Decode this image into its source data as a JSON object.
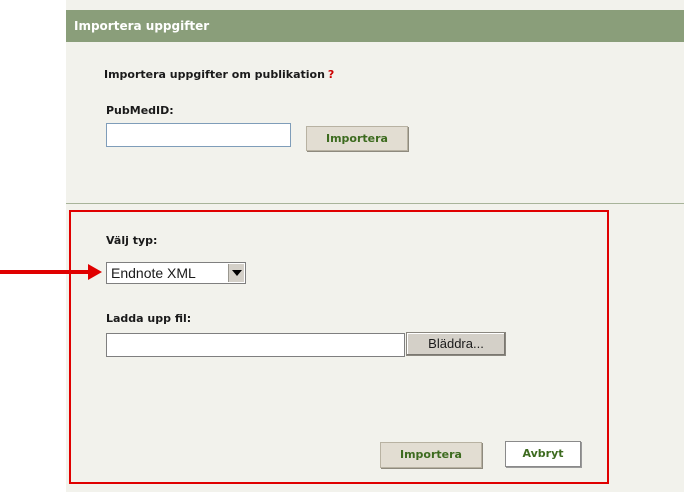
{
  "header": {
    "title": "Importera uppgifter"
  },
  "pubmed_section": {
    "title": "Importera uppgifter om publikation",
    "help_mark": "?",
    "pubmed_label": "PubMedID:",
    "pubmed_value": "",
    "import_button": "Importera"
  },
  "file_section": {
    "type_label": "Välj typ:",
    "type_selected": "Endnote XML",
    "upload_label": "Ladda upp fil:",
    "file_value": "",
    "browse_button": "Bläddra...",
    "import_button": "Importera",
    "cancel_button": "Avbryt"
  },
  "annotation": {
    "color": "#e00000"
  }
}
